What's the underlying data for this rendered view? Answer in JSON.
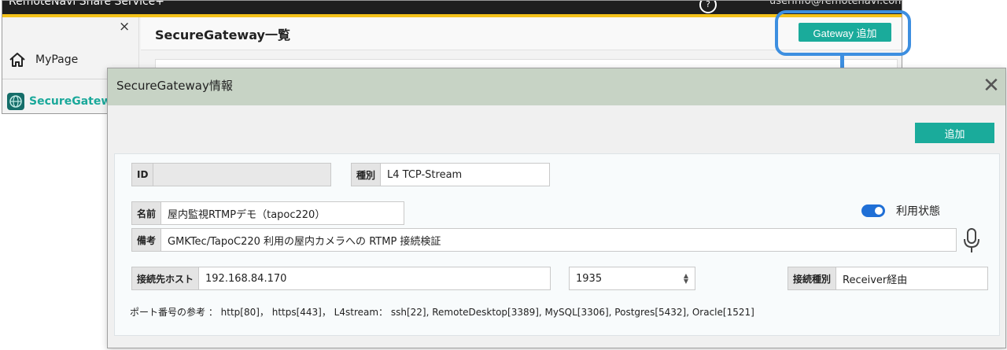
{
  "app": {
    "title": "RemoteNavi Share Service+",
    "help_glyph": "?",
    "user": "userinfo@remotenavi.com"
  },
  "sidebar": {
    "close_glyph": "×",
    "items": [
      {
        "label": "MyPage",
        "icon": "home-icon"
      },
      {
        "label": "SecureGateway",
        "icon": "globe-icon",
        "active": true
      }
    ]
  },
  "main": {
    "title": "SecureGateway一覧",
    "gateway_add_label": "Gateway 追加"
  },
  "modal": {
    "title": "SecureGateway情報",
    "close_glyph": "✕",
    "add_label": "追加",
    "fields": {
      "id": {
        "label": "ID",
        "value": ""
      },
      "type": {
        "label": "種別",
        "value": "L4 TCP-Stream"
      },
      "name": {
        "label": "名前",
        "value": "屋内監視RTMPデモ（tapoc220）"
      },
      "note": {
        "label": "備考",
        "value": "GMKTec/TapoC220 利用の屋内カメラへの RTMP 接続検証"
      },
      "host": {
        "label": "接続先ホスト",
        "value": "192.168.84.170"
      },
      "port": {
        "value": "1935"
      },
      "conn_type": {
        "label": "接続種別",
        "value": "Receiver経由"
      }
    },
    "status": {
      "label": "利用状態",
      "on": true
    },
    "port_hint": "ポート番号の参考 ： http[80]， https[443]， L4stream： ssh[22], RemoteDesktop[3389], MySQL[3306], Postgres[5432], Oracle[1521]"
  },
  "colors": {
    "accent": "#1aab9b",
    "header_bar": "#f4c21a",
    "highlight": "#3d8fe0",
    "modal_header": "#c7d3c5",
    "toggle_on": "#1f6fd6"
  }
}
